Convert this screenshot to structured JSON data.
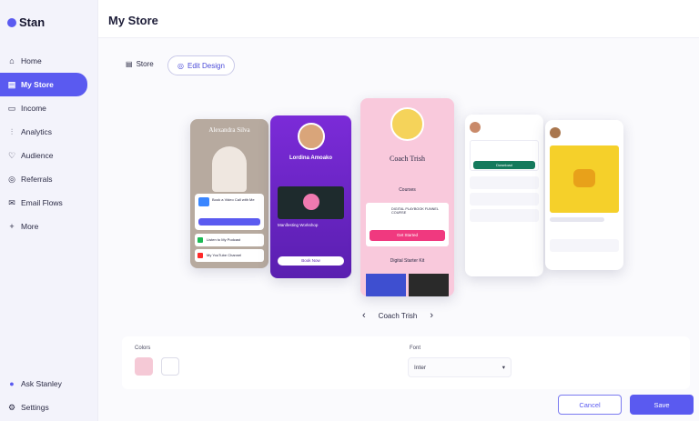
{
  "brand": {
    "name": "Stan",
    "icon": "stan-logo-icon"
  },
  "sidebar": {
    "items": [
      {
        "label": "Home",
        "icon": "home-icon"
      },
      {
        "label": "My Store",
        "icon": "store-icon"
      },
      {
        "label": "Income",
        "icon": "wallet-icon"
      },
      {
        "label": "Analytics",
        "icon": "analytics-icon"
      },
      {
        "label": "Audience",
        "icon": "heart-icon"
      },
      {
        "label": "Referrals",
        "icon": "referrals-icon"
      },
      {
        "label": "Email Flows",
        "icon": "email-icon"
      },
      {
        "label": "More",
        "icon": "plus-icon"
      }
    ],
    "bottom": [
      {
        "label": "Ask Stanley",
        "icon": "stanley-icon"
      },
      {
        "label": "Settings",
        "icon": "gear-icon"
      }
    ]
  },
  "header": {
    "title": "My Store"
  },
  "toolbar": {
    "store_label": "Store",
    "edit_design_label": "Edit Design"
  },
  "previews": {
    "card1": {
      "name": "Alexandra Silva",
      "rows": [
        "Book a Video Call with Me",
        "Listen to My Podcast",
        "My YouTube Channel"
      ]
    },
    "card2": {
      "name": "Lordina Amoako",
      "item": "Manifesting Workshop",
      "button": "Book Now"
    },
    "card3": {
      "name": "Coach Trish",
      "section": "Courses",
      "course": "DIGITAL PLAYBOOK FUNNEL COURSE",
      "button": "Get Started",
      "section2": "Digital Starter Kit"
    },
    "card4": {
      "button": "Download"
    },
    "card5": {}
  },
  "carousel": {
    "current": "Coach Trish"
  },
  "settings": {
    "colors_label": "Colors",
    "font_label": "Font",
    "font_value": "Inter",
    "colors": {
      "primary": "#f5c9d6",
      "secondary": "#ffffff"
    }
  },
  "actions": {
    "cancel": "Cancel",
    "save": "Save"
  },
  "theme": {
    "accent": "#5a5af0"
  }
}
